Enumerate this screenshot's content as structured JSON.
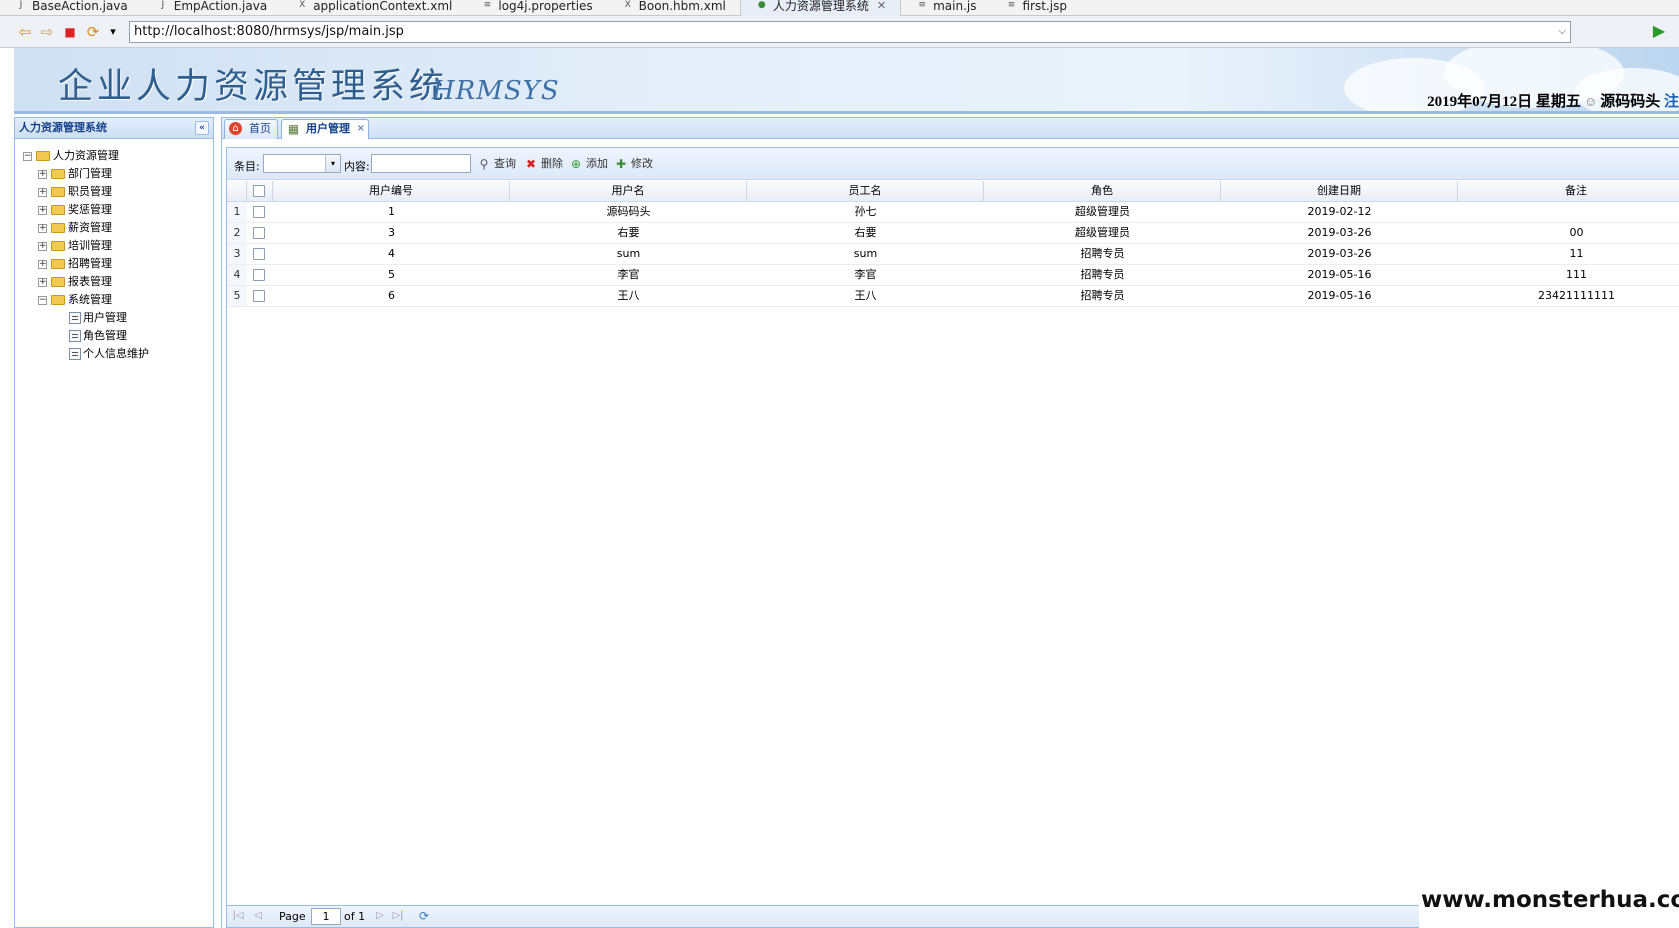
{
  "editor_tabs": [
    {
      "label": "BaseAction.java",
      "icon": "java-file-icon",
      "glyph": "J"
    },
    {
      "label": "EmpAction.java",
      "icon": "java-file-icon",
      "glyph": "J"
    },
    {
      "label": "applicationContext.xml",
      "icon": "xml-file-icon",
      "glyph": "X"
    },
    {
      "label": "log4j.properties",
      "icon": "properties-file-icon",
      "glyph": "≡"
    },
    {
      "label": "Boon.hbm.xml",
      "icon": "xml-file-icon",
      "glyph": "X"
    },
    {
      "label": "人力资源管理系统",
      "icon": "web-browser-icon",
      "glyph": "●",
      "active": true,
      "close": "✕"
    },
    {
      "label": "main.js",
      "icon": "js-file-icon",
      "glyph": "≡"
    },
    {
      "label": "first.jsp",
      "icon": "jsp-file-icon",
      "glyph": "≡"
    }
  ],
  "browser": {
    "url": "http://localhost:8080/hrmsys/jsp/main.jsp",
    "back": "⇦",
    "forward": "⇨",
    "stop": "■",
    "refresh": "⟳",
    "menu": "▾",
    "go": "▶",
    "url_drop": "⌵"
  },
  "banner": {
    "title": "企业人力资源管理系统",
    "subtitle": "HRMSYS",
    "date": "2019年07月12日 星期五",
    "user": "源码码头",
    "logout": "注"
  },
  "left_panel": {
    "title": "人力资源管理系统",
    "collapse": "«",
    "tree": [
      {
        "label": "人力资源管理",
        "level": 0,
        "toggle": "−",
        "type": "folder"
      },
      {
        "label": "部门管理",
        "level": 1,
        "toggle": "+",
        "type": "folder"
      },
      {
        "label": "职员管理",
        "level": 1,
        "toggle": "+",
        "type": "folder"
      },
      {
        "label": "奖惩管理",
        "level": 1,
        "toggle": "+",
        "type": "folder"
      },
      {
        "label": "薪资管理",
        "level": 1,
        "toggle": "+",
        "type": "folder"
      },
      {
        "label": "培训管理",
        "level": 1,
        "toggle": "+",
        "type": "folder"
      },
      {
        "label": "招聘管理",
        "level": 1,
        "toggle": "+",
        "type": "folder"
      },
      {
        "label": "报表管理",
        "level": 1,
        "toggle": "+",
        "type": "folder"
      },
      {
        "label": "系统管理",
        "level": 1,
        "toggle": "−",
        "type": "folder"
      },
      {
        "label": "用户管理",
        "level": 2,
        "toggle": "",
        "type": "leaf"
      },
      {
        "label": "角色管理",
        "level": 2,
        "toggle": "",
        "type": "leaf"
      },
      {
        "label": "个人信息维护",
        "level": 2,
        "toggle": "",
        "type": "leaf"
      }
    ]
  },
  "content_tabs": {
    "home": "首页",
    "home_icon": "⌂",
    "user_mgmt": "用户管理",
    "user_icon": "▦",
    "close": "×"
  },
  "search": {
    "field_label": "条目:",
    "field_value": "",
    "content_label": "内容:",
    "content_value": "",
    "arrow": "▾",
    "query": "查询",
    "query_glyph": "⚲",
    "delete": "删除",
    "delete_glyph": "✖",
    "add": "添加",
    "add_glyph": "⊕",
    "edit": "修改",
    "edit_glyph": "✚"
  },
  "grid": {
    "columns": [
      "用户编号",
      "用户名",
      "员工名",
      "角色",
      "创建日期",
      "备注"
    ],
    "rows": [
      {
        "n": "1",
        "id": "1",
        "username": "源码码头",
        "emp": "孙七",
        "role": "超级管理员",
        "date": "2019-02-12",
        "remark": ""
      },
      {
        "n": "2",
        "id": "3",
        "username": "右要",
        "emp": "右要",
        "role": "超级管理员",
        "date": "2019-03-26",
        "remark": "00"
      },
      {
        "n": "3",
        "id": "4",
        "username": "sum",
        "emp": "sum",
        "role": "招聘专员",
        "date": "2019-03-26",
        "remark": "11"
      },
      {
        "n": "4",
        "id": "5",
        "username": "李官",
        "emp": "李官",
        "role": "招聘专员",
        "date": "2019-05-16",
        "remark": "111"
      },
      {
        "n": "5",
        "id": "6",
        "username": "王八",
        "emp": "王八",
        "role": "招聘专员",
        "date": "2019-05-16",
        "remark": "23421111111"
      }
    ]
  },
  "pager": {
    "page_label": "Page",
    "page_value": "1",
    "of_label": "of 1",
    "first": "|◁",
    "prev": "◁",
    "next": "▷",
    "last": "▷|",
    "refresh": "⟳"
  },
  "watermark": "www.monsterhua.com"
}
